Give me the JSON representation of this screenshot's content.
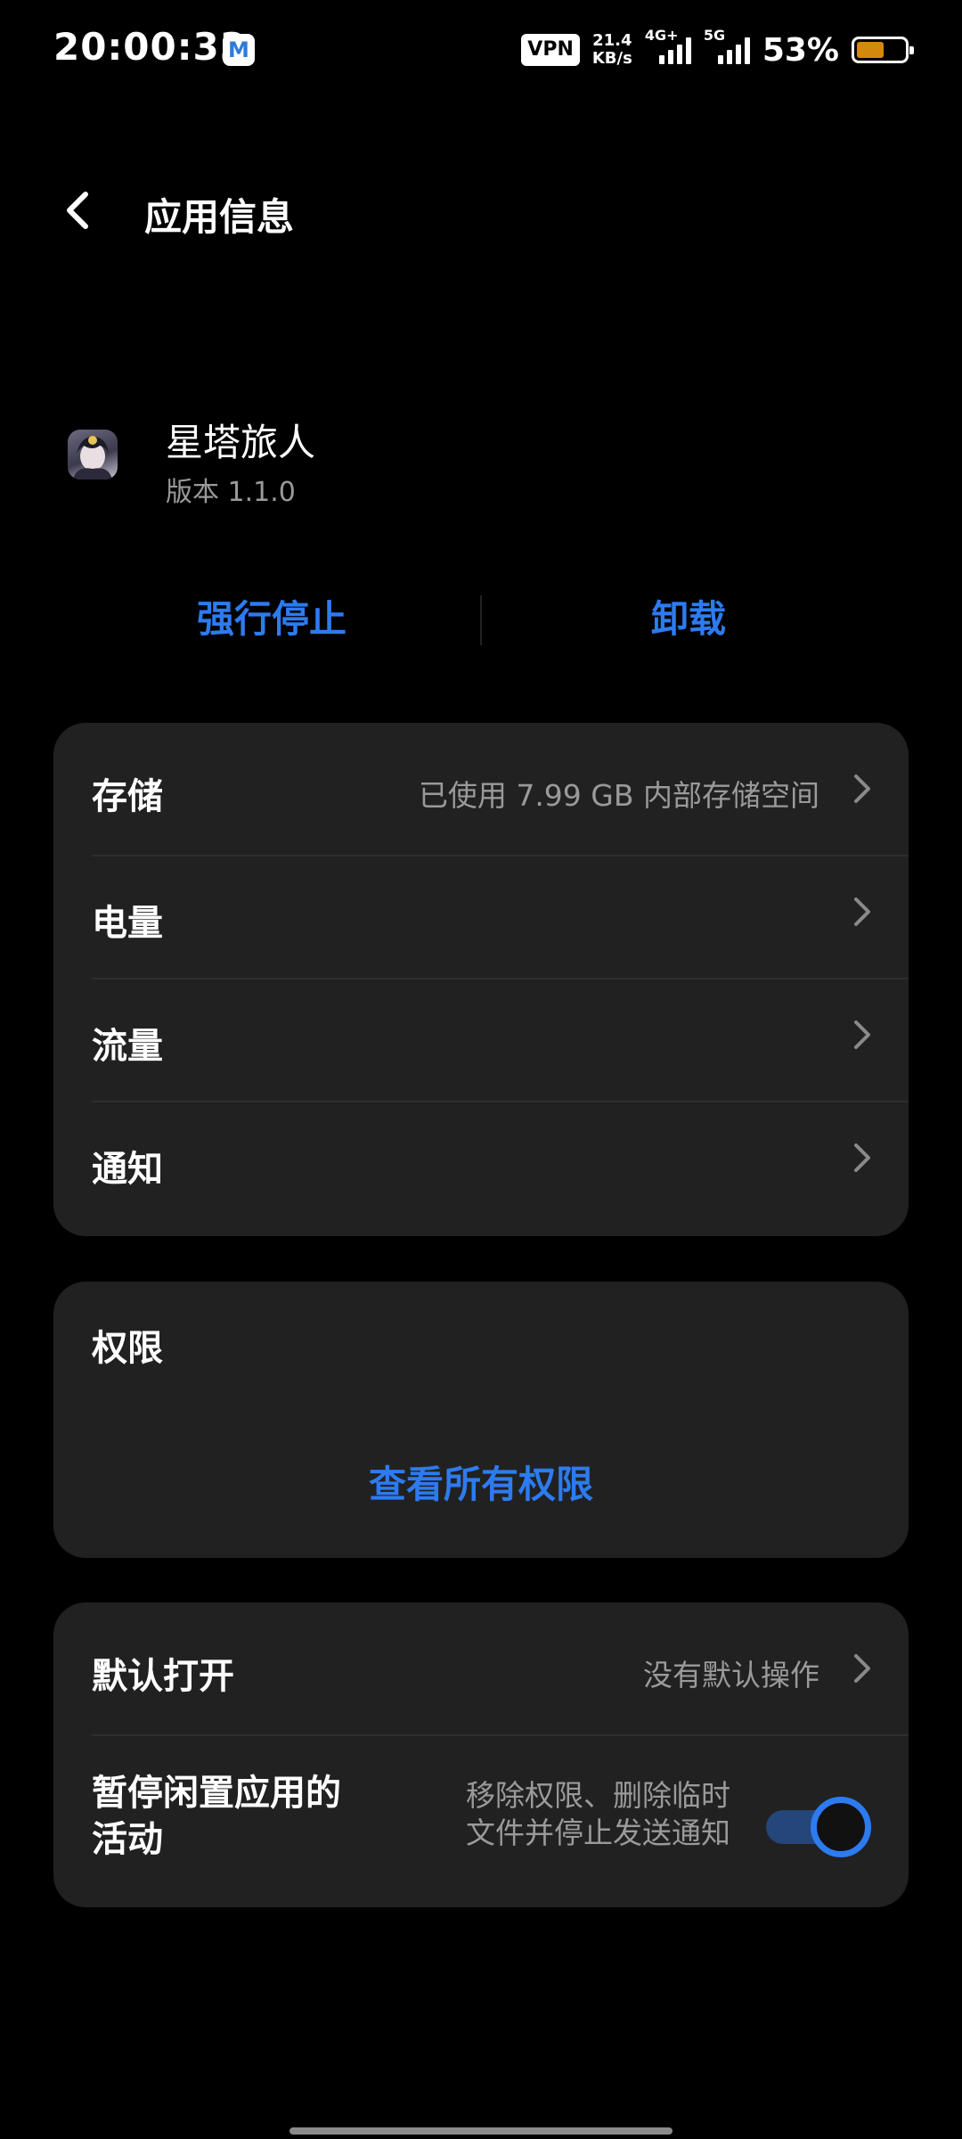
{
  "status_bar": {
    "time": "20:00:33",
    "mail_glyph": "M",
    "vpn": "VPN",
    "speed_value": "21.4",
    "speed_unit": "KB/s",
    "sim1": "4G+",
    "sim2": "5G",
    "battery_percent": "53%",
    "battery_color": "#d4890c"
  },
  "header": {
    "title": "应用信息"
  },
  "app": {
    "name": "星塔旅人",
    "version": "版本 1.1.0"
  },
  "actions": {
    "force_stop": "强行停止",
    "uninstall": "卸载"
  },
  "details": [
    {
      "label": "存储",
      "value": "已使用 7.99 GB 内部存储空间"
    },
    {
      "label": "电量",
      "value": ""
    },
    {
      "label": "流量",
      "value": ""
    },
    {
      "label": "通知",
      "value": ""
    }
  ],
  "permissions": {
    "title": "权限",
    "view_all": "查看所有权限"
  },
  "defaults": {
    "open_by_default_label": "默认打开",
    "open_by_default_value": "没有默认操作",
    "pause_label_line1": "暂停闲置应用的",
    "pause_label_line2": "活动",
    "pause_desc_line1": "移除权限、删除临时",
    "pause_desc_line2": "文件并停止发送通知",
    "pause_enabled": true
  },
  "colors": {
    "accent": "#2d7bf0",
    "card": "#212121",
    "background": "#000000"
  }
}
